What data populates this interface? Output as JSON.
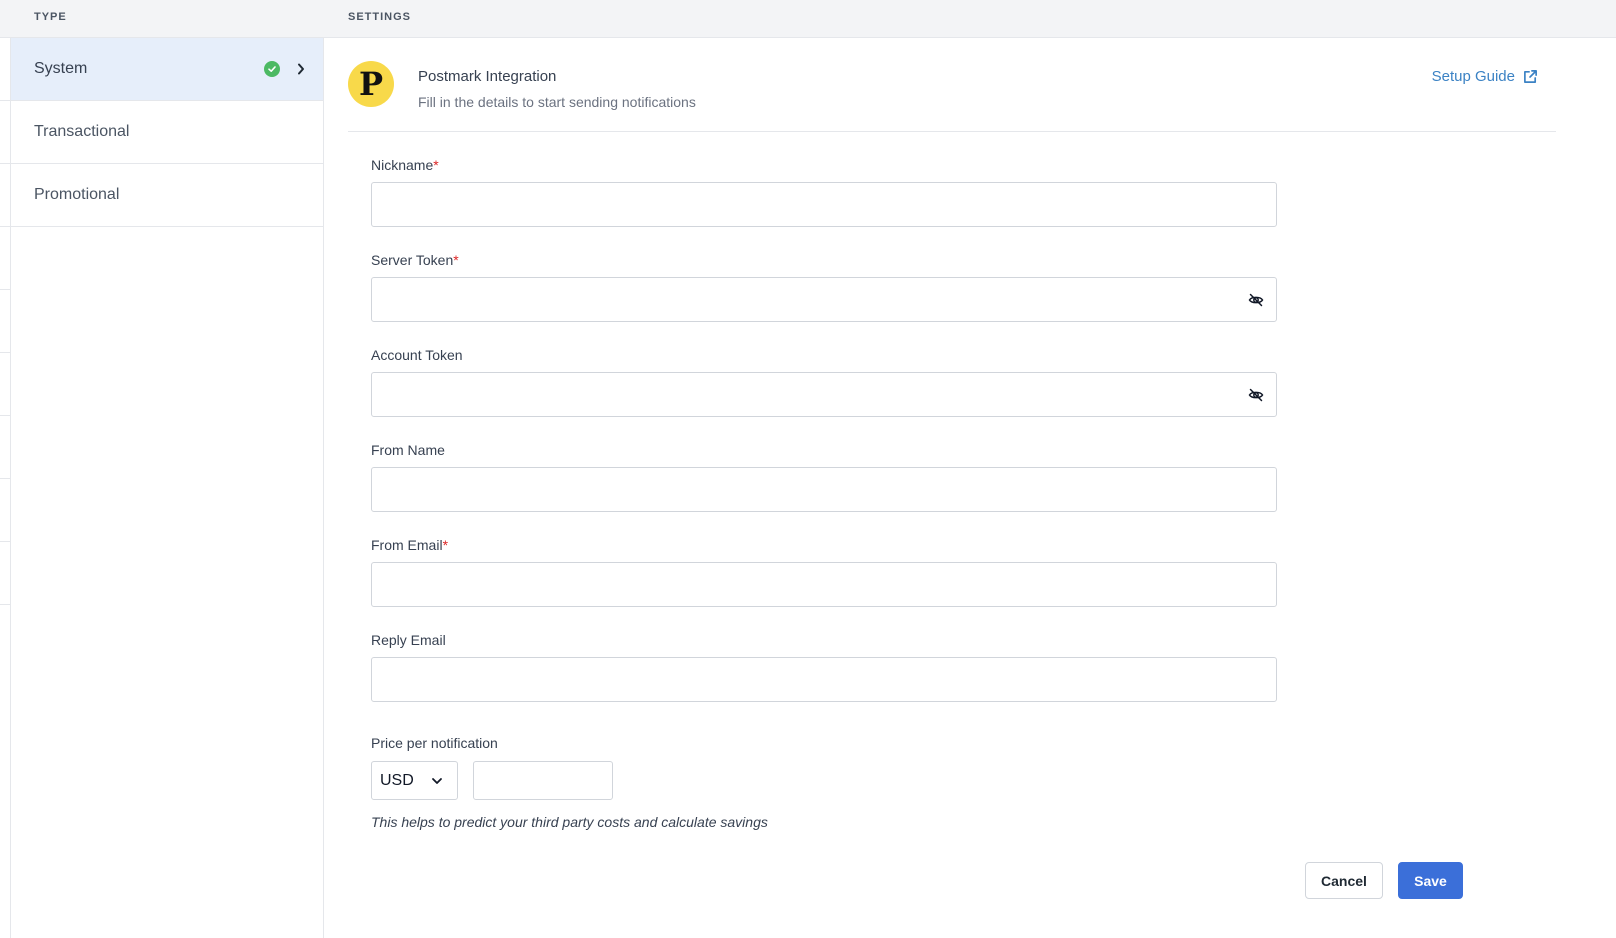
{
  "columns": {
    "type_header": "TYPE",
    "settings_header": "SETTINGS"
  },
  "sidebar": {
    "items": [
      {
        "label": "System",
        "active": true,
        "status": "check-icon"
      },
      {
        "label": "Transactional"
      },
      {
        "label": "Promotional"
      }
    ]
  },
  "integration": {
    "logo_letter": "P",
    "title": "Postmark Integration",
    "subtitle": "Fill in the details to start sending notifications",
    "setup_guide": "Setup Guide"
  },
  "form": {
    "nickname": {
      "label": "Nickname",
      "required_mark": "*",
      "value": ""
    },
    "server_token": {
      "label": "Server Token",
      "required_mark": "*",
      "value": ""
    },
    "account_token": {
      "label": "Account Token",
      "value": ""
    },
    "from_name": {
      "label": "From Name",
      "value": ""
    },
    "from_email": {
      "label": "From Email",
      "required_mark": "*",
      "value": ""
    },
    "reply_email": {
      "label": "Reply Email",
      "value": ""
    },
    "price": {
      "label": "Price per notification",
      "currency": "USD",
      "value": "",
      "helper": "This helps to predict your third party costs and calculate savings"
    }
  },
  "actions": {
    "cancel": "Cancel",
    "save": "Save"
  },
  "colors": {
    "accent": "#3b6fd9",
    "link": "#3b82c4",
    "required": "#dc2626",
    "success": "#4cb963",
    "logo_bg": "#f8d94a"
  }
}
